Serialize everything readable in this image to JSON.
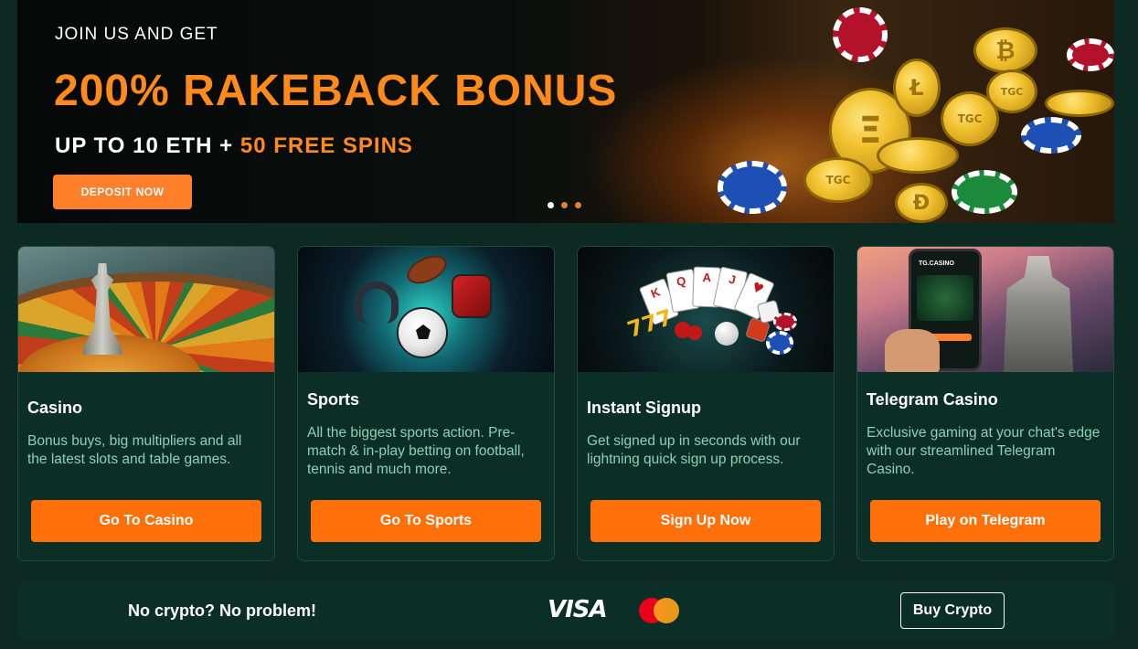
{
  "hero": {
    "kicker": "JOIN US AND GET",
    "title": "200% RAKEBACK BONUS",
    "subtitle_main": "UP TO 10 ETH + ",
    "subtitle_accent": "50 FREE SPINS",
    "deposit_label": "DEPOSIT NOW",
    "slides_total": 3,
    "active_slide": 1,
    "coin_marks": [
      "₿",
      "Ξ",
      "Ł",
      "TGC",
      "TGC",
      "TGC",
      "Ð"
    ]
  },
  "cards": [
    {
      "title": "Casino",
      "description": "Bonus buys, big multipliers and all the latest slots and table games.",
      "button": "Go To Casino"
    },
    {
      "title": "Sports",
      "description": "All the biggest sports action. Pre-match & in-play betting on football, tennis and much more.",
      "button": "Go To Sports"
    },
    {
      "title": "Instant Signup",
      "description": "Get signed up in seconds with our lightning quick sign up process.",
      "button": "Sign Up Now"
    },
    {
      "title": "Telegram Casino",
      "description": "Exclusive gaming at your chat's edge with our streamlined Telegram Casino.",
      "button": "Play on Telegram"
    }
  ],
  "signup_art": {
    "card_faces": [
      "K",
      "Q",
      "A",
      "J",
      "♥"
    ],
    "sevens": "777"
  },
  "telegram_art": {
    "screen_brand": "TG.CASINO"
  },
  "crypto_strip": {
    "text": "No crypto? No problem!",
    "visa_label": "VISA",
    "mastercard_icon": "mastercard-logo",
    "buy_button": "Buy Crypto"
  },
  "colors": {
    "background": "#0d2a22",
    "card_bg": "#0b2f27",
    "accent_orange": "#ff6f0a",
    "hero_orange": "#ff8a1c",
    "desc_green": "#8fcfb4"
  }
}
